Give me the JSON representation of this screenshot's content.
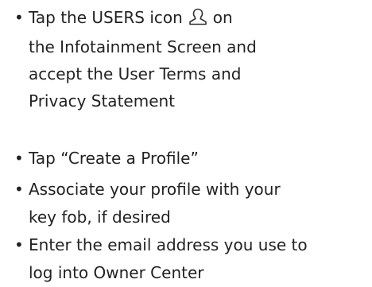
{
  "items": [
    {
      "lines": [
        "Tap the USERS icon",
        "on",
        "the Infotainment Screen and",
        "accept the User Terms and",
        "Privacy Statement"
      ],
      "icon": "user-icon"
    },
    {
      "lines": [
        "Tap “Create a Profile”"
      ]
    },
    {
      "lines": [
        "Associate your profile with your",
        "key fob, if desired"
      ]
    },
    {
      "lines": [
        "Enter the email address you use to",
        "log into Owner Center"
      ]
    }
  ],
  "bullet": "•",
  "colors": {
    "text": "#222222",
    "icon_stroke": "#333333"
  }
}
